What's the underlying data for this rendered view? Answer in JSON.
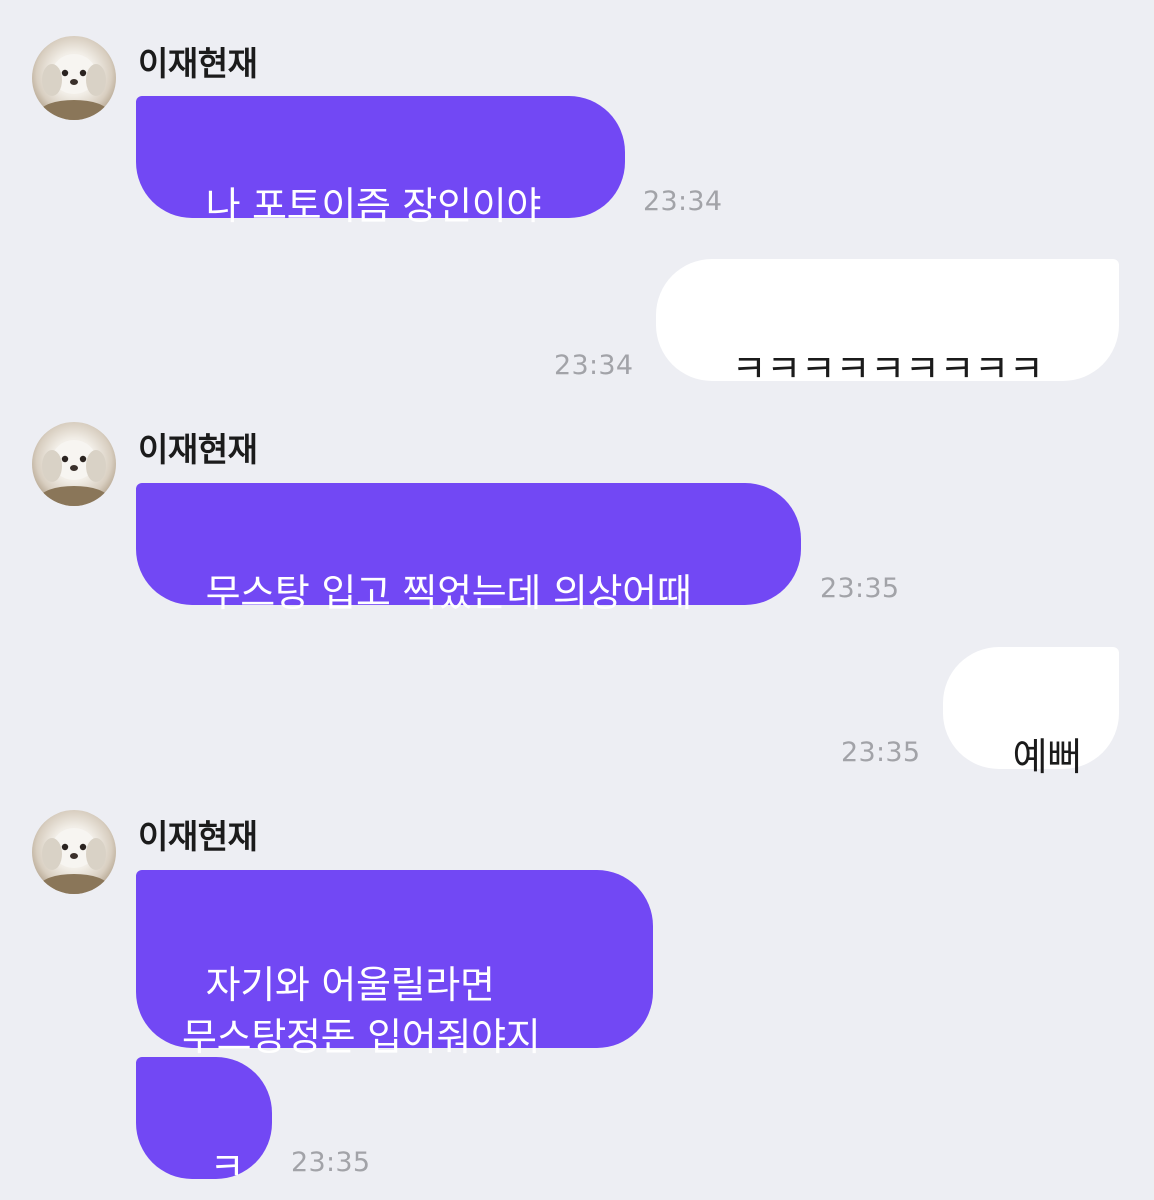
{
  "sender": {
    "name": "이재현재",
    "avatar": "shih-tzu-dog-photo"
  },
  "messages": [
    {
      "direction": "incoming",
      "text": "나 포토이즘 장인이야",
      "time": "23:34"
    },
    {
      "direction": "outgoing",
      "text": "ㅋㅋㅋㅋㅋㅋㅋㅋㅋ",
      "time": "23:34"
    },
    {
      "direction": "incoming",
      "text": "무스탕 입고 찍었는데 의상어때",
      "time": "23:35"
    },
    {
      "direction": "outgoing",
      "text": "예뻐",
      "time": "23:35"
    },
    {
      "direction": "incoming",
      "text": "자기와 어울릴라면\n무스탕정돈 입어줘야지"
    },
    {
      "direction": "incoming",
      "text": "ㅋ",
      "time": "23:35"
    }
  ],
  "colors": {
    "background": "#edeef3",
    "incoming_bubble": "#7248f4",
    "outgoing_bubble": "#ffffff",
    "timestamp": "#a2a3a8"
  }
}
